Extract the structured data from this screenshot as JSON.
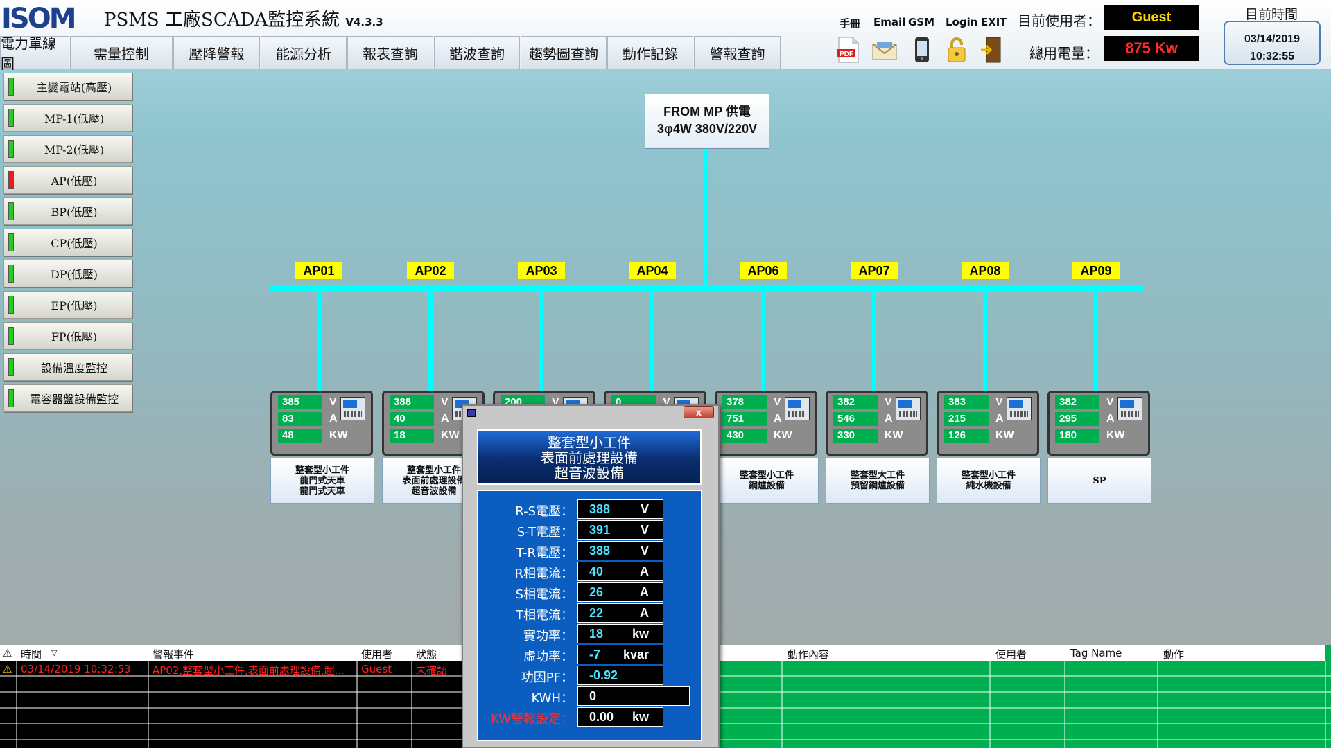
{
  "header": {
    "logo": "ISOM",
    "title": "PSMS 工廠SCADA監控系統",
    "version": "V4.3.3",
    "menu": [
      "電力單線圖",
      "需量控制",
      "壓降警報",
      "能源分析",
      "報表查詢",
      "諧波查詢",
      "趨勢圖查詢",
      "動作記錄",
      "警報查詢"
    ],
    "tools": [
      {
        "label": "手冊",
        "icon": "pdf-icon"
      },
      {
        "label": "Email",
        "icon": "email-icon"
      },
      {
        "label": "GSM",
        "icon": "phone-icon"
      },
      {
        "label": "Login",
        "icon": "lock-icon"
      },
      {
        "label": "EXIT",
        "icon": "exit-door-icon"
      }
    ],
    "user_label": "目前使用者：",
    "user_value": "Guest",
    "power_label": "總用電量：",
    "power_value": "875 Kw",
    "time_label": "目前時間",
    "date": "03/14/2019",
    "time": "10:32:55"
  },
  "sidebar": {
    "items": [
      {
        "label": "主變電站(高壓)",
        "status": "green"
      },
      {
        "label": "MP-1(低壓)",
        "status": "green"
      },
      {
        "label": "MP-2(低壓)",
        "status": "green"
      },
      {
        "label": "AP(低壓)",
        "status": "red"
      },
      {
        "label": "BP(低壓)",
        "status": "green"
      },
      {
        "label": "CP(低壓)",
        "status": "green"
      },
      {
        "label": "DP(低壓)",
        "status": "green"
      },
      {
        "label": "EP(低壓)",
        "status": "green"
      },
      {
        "label": "FP(低壓)",
        "status": "green"
      },
      {
        "label": "設備溫度監控",
        "status": "green"
      },
      {
        "label": "電容器盤設備監控",
        "status": "green"
      }
    ]
  },
  "diagram": {
    "source_line1": "FROM MP 供電",
    "source_line2": "3φ4W 380V/220V",
    "panels": [
      {
        "name": "AP01",
        "v": "385",
        "a": "83",
        "kw": "48",
        "desc": "整套型小工件\n龍門式天車\n龍門式天車"
      },
      {
        "name": "AP02",
        "v": "388",
        "a": "40",
        "kw": "18",
        "desc": "整套型小工件\n表面前處理設備\n超音波設備"
      },
      {
        "name": "AP03",
        "v": "200",
        "a": "",
        "kw": "",
        "desc": ""
      },
      {
        "name": "AP04",
        "v": "0",
        "a": "",
        "kw": "",
        "desc": ""
      },
      {
        "name": "AP06",
        "v": "378",
        "a": "751",
        "kw": "430",
        "desc": "整套型小工件\n鋼爐設備"
      },
      {
        "name": "AP07",
        "v": "382",
        "a": "546",
        "kw": "330",
        "desc": "整套型大工件\n預留鋼爐設備"
      },
      {
        "name": "AP08",
        "v": "383",
        "a": "215",
        "kw": "126",
        "desc": "整套型小工件\n純水機設備"
      },
      {
        "name": "AP09",
        "v": "382",
        "a": "295",
        "kw": "180",
        "desc": "SP"
      }
    ],
    "units": {
      "v": "V",
      "a": "A",
      "kw": "KW"
    }
  },
  "alarms": {
    "headers": [
      "時間",
      "警報事件",
      "使用者",
      "狀態"
    ],
    "rows": [
      {
        "time": "03/14/2019 10:32:53",
        "event": "AP02,整套型小工件,表面前處理設備,超...",
        "user": "Guest",
        "status": "未確認"
      }
    ]
  },
  "actions": {
    "headers": [
      "動作內容",
      "使用者",
      "Tag Name",
      "動作"
    ]
  },
  "dialog": {
    "close": "x",
    "title_line1": "整套型小工件",
    "title_line2": "表面前處理設備",
    "title_line3": "超音波設備",
    "rows": [
      {
        "label": "R-S電壓：",
        "value": "388",
        "unit": "V"
      },
      {
        "label": "S-T電壓：",
        "value": "391",
        "unit": "V"
      },
      {
        "label": "T-R電壓：",
        "value": "388",
        "unit": "V"
      },
      {
        "label": "R相電流：",
        "value": "40",
        "unit": "A"
      },
      {
        "label": "S相電流：",
        "value": "26",
        "unit": "A"
      },
      {
        "label": "T相電流：",
        "value": "22",
        "unit": "A"
      },
      {
        "label": "實功率：",
        "value": "18",
        "unit": "kw"
      },
      {
        "label": "虛功率：",
        "value": "-7",
        "unit": "kvar"
      },
      {
        "label": "功因PF：",
        "value": "-0.92",
        "unit": ""
      },
      {
        "label": "KWH：",
        "value": "0",
        "unit": ""
      },
      {
        "label": "KW警報設定：",
        "value": "0.00",
        "unit": "kw"
      }
    ]
  },
  "colors": {
    "accent": "#00ffff",
    "alarm": "#ff2020",
    "ok": "#00b050",
    "label": "#ffff00"
  }
}
